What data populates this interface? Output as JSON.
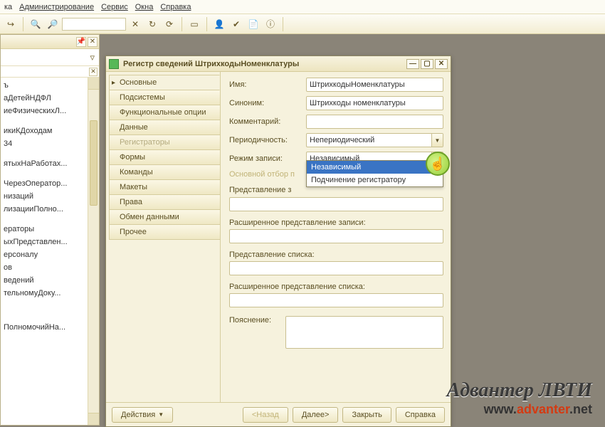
{
  "menu": {
    "items": [
      "ка",
      "Администрирование",
      "Сервис",
      "Окна",
      "Справка"
    ],
    "underlines": [
      null,
      0,
      0,
      0,
      0
    ]
  },
  "tree": {
    "items": [
      "ъ",
      "аДетейНДФЛ",
      "иеФизическихЛ...",
      "",
      "икиКДоходам",
      "34",
      "",
      "ятыхНаРаботах...",
      "",
      "ЧерезОператор...",
      "низаций",
      "лизацииПолно...",
      "",
      "ераторы",
      "ыхПредставлен...",
      "ерсоналу",
      "ов",
      "ведений",
      "тельномуДоку...",
      "",
      "",
      "",
      "ПолномочийНа..."
    ]
  },
  "dialog": {
    "title": "Регистр сведений ШтрихкодыНоменклатуры",
    "tabs": [
      {
        "label": "Основные",
        "state": "active"
      },
      {
        "label": "Подсистемы",
        "state": ""
      },
      {
        "label": "Функциональные опции",
        "state": ""
      },
      {
        "label": "Данные",
        "state": ""
      },
      {
        "label": "Регистраторы",
        "state": "disabled"
      },
      {
        "label": "Формы",
        "state": ""
      },
      {
        "label": "Команды",
        "state": ""
      },
      {
        "label": "Макеты",
        "state": ""
      },
      {
        "label": "Права",
        "state": ""
      },
      {
        "label": "Обмен данными",
        "state": ""
      },
      {
        "label": "Прочее",
        "state": ""
      }
    ],
    "form": {
      "name_label": "Имя:",
      "name_value": "ШтрихкодыНоменклатуры",
      "synonym_label": "Синоним:",
      "synonym_value": "Штрихкоды номенклатуры",
      "comment_label": "Комментарий:",
      "comment_value": "",
      "period_label": "Периодичность:",
      "period_value": "Непериодический",
      "writemode_label": "Режим записи:",
      "writemode_value": "Независимый",
      "writemode_options": [
        "Независимый",
        "Подчинение регистратору"
      ],
      "mainfilter_label": "Основной отбор п",
      "record_presentation_label": "Представление з",
      "ext_record_presentation_label": "Расширенное представление записи:",
      "list_presentation_label": "Представление списка:",
      "ext_list_presentation_label": "Расширенное представление списка:",
      "explanation_label": "Пояснение:"
    },
    "footer": {
      "actions": "Действия",
      "back": "<Назад",
      "next": "Далее>",
      "close": "Закрыть",
      "help": "Справка"
    }
  },
  "watermark": {
    "line1": "Адвантер ЛВТИ",
    "line2_pre": "www.",
    "line2_accent": "advanter",
    "line2_post": ".net"
  }
}
